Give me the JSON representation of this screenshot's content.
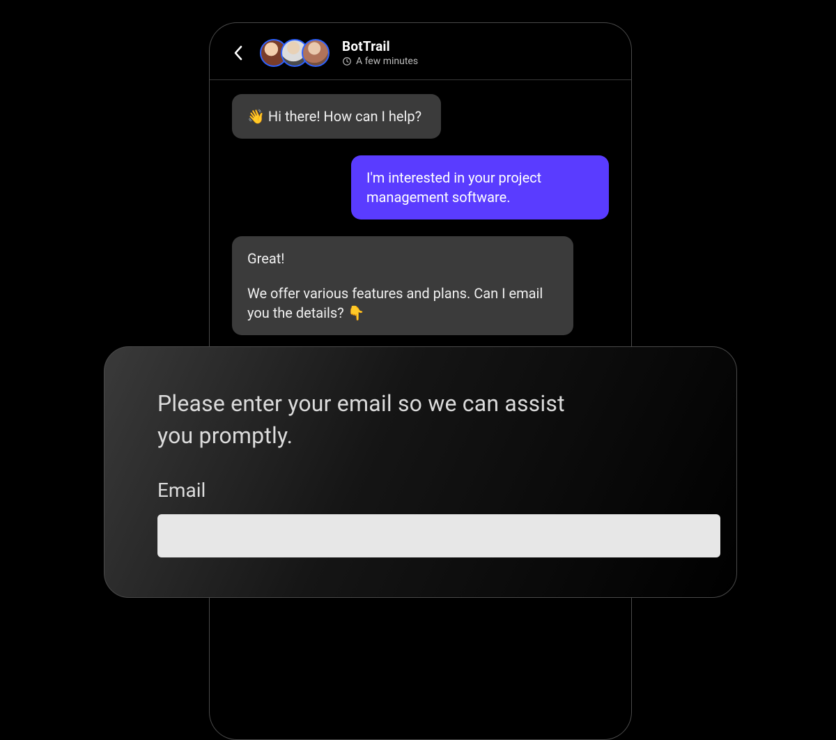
{
  "header": {
    "title": "BotTrail",
    "subtitle": "A few minutes",
    "avatar_count": 3
  },
  "messages": {
    "bot_1": "👋 Hi there! How can I help?",
    "user_1": "I'm interested in your project management software.",
    "bot_2_line1": "Great!",
    "bot_2_line2": "We offer various features and plans. Can I email you the details? 👇"
  },
  "sheet": {
    "prompt": "Please enter your email so we can assist you promptly.",
    "field_label": "Email",
    "email_value": ""
  }
}
